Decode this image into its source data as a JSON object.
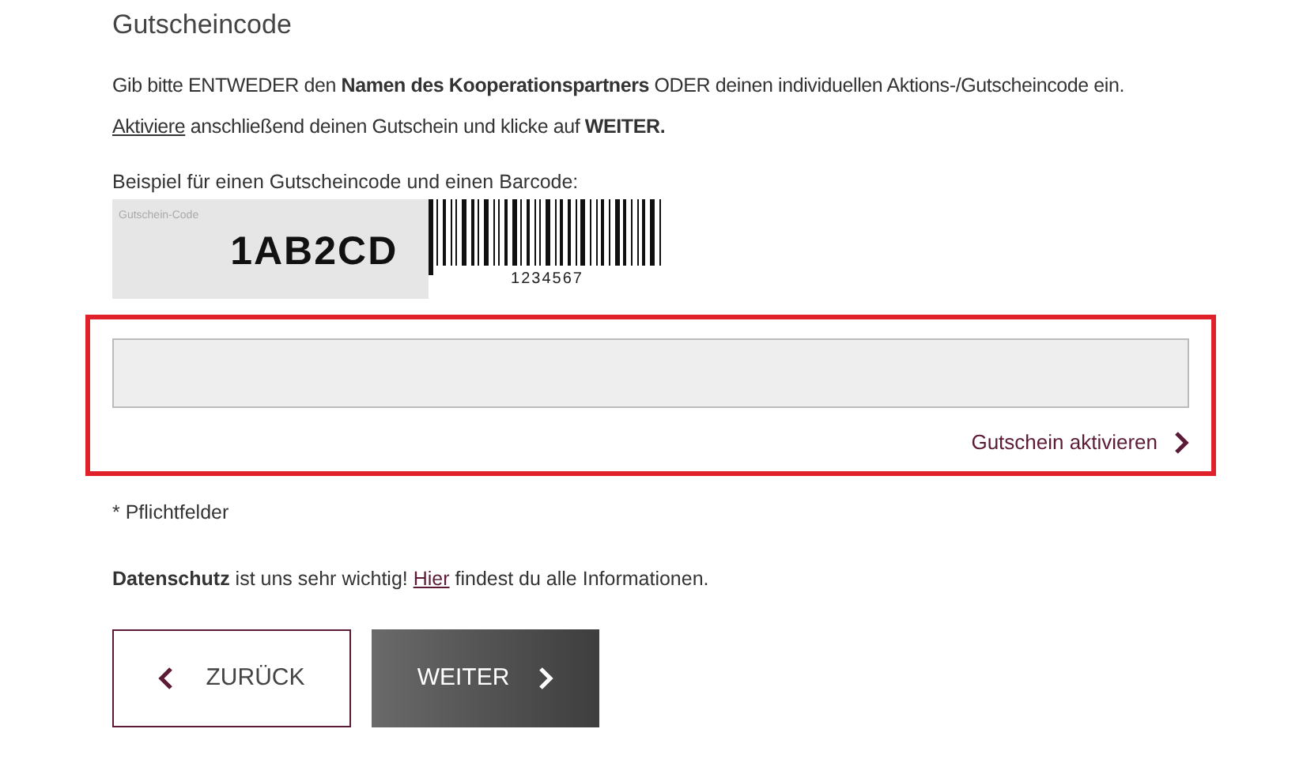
{
  "heading": "Gutscheincode",
  "instruction": {
    "line1": "Gib bitte ENTWEDER den **Namen des Kooperationspartners** ODER deinen individuellen Aktions-/Gutscheincode ein.",
    "link": "Aktiviere",
    "line2": " anschließend deinen Gutschein und klicke auf **WEITER.**"
  },
  "example": {
    "caption": "Beispiel für einen Gutscheincode und einen Barcode:",
    "code_label": "Gutschein-Code",
    "code": "1AB2CD",
    "barcode_number": "1234567"
  },
  "activate_link": "Gutschein aktivieren",
  "required_note": "* Pflichtfelder",
  "privacy": {
    "bold": "Datenschutz",
    "before": " ist uns sehr wichtig! ",
    "link": "Hier",
    "after": " findest du alle Informationen."
  },
  "buttons": [
    {
      "kind": "back",
      "label": "ZURÜCK"
    },
    {
      "kind": "next",
      "label": "WEITER"
    }
  ]
}
